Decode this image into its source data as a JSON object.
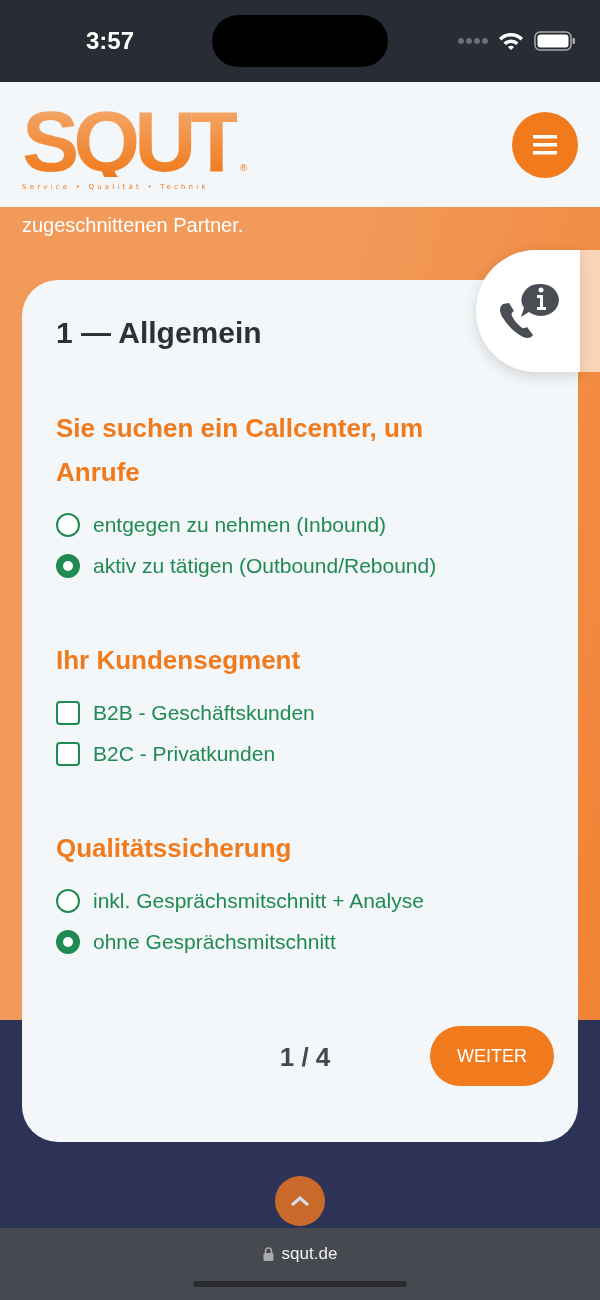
{
  "status_bar": {
    "time": "3:57"
  },
  "header": {
    "logo": {
      "wordmark": "SQUT",
      "registered": "®",
      "tagline": "Service • Qualität • Technik"
    }
  },
  "hero_text": "zugeschnittenen Partner.",
  "form": {
    "title": "1 — Allgemein",
    "sections": [
      {
        "heading": "Sie suchen ein Callcenter, um Anrufe",
        "kind": "radio",
        "options": [
          {
            "label": "entgegen zu nehmen (Inbound)",
            "selected": false
          },
          {
            "label": "aktiv zu tätigen (Outbound/Rebound)",
            "selected": true
          }
        ]
      },
      {
        "heading": "Ihr Kundensegment",
        "kind": "checkbox",
        "options": [
          {
            "label": "B2B - Geschäftskunden",
            "checked": false
          },
          {
            "label": "B2C - Privatkunden",
            "checked": false
          }
        ]
      },
      {
        "heading": "Qualitätssicherung",
        "kind": "radio",
        "options": [
          {
            "label": "inkl. Gesprächsmitschnitt + Analyse",
            "selected": false
          },
          {
            "label": "ohne Gesprächsmitschnitt",
            "selected": true
          }
        ]
      }
    ],
    "pager": "1 / 4",
    "next_button": "WEITER"
  },
  "browser": {
    "url": "squt.de"
  }
}
